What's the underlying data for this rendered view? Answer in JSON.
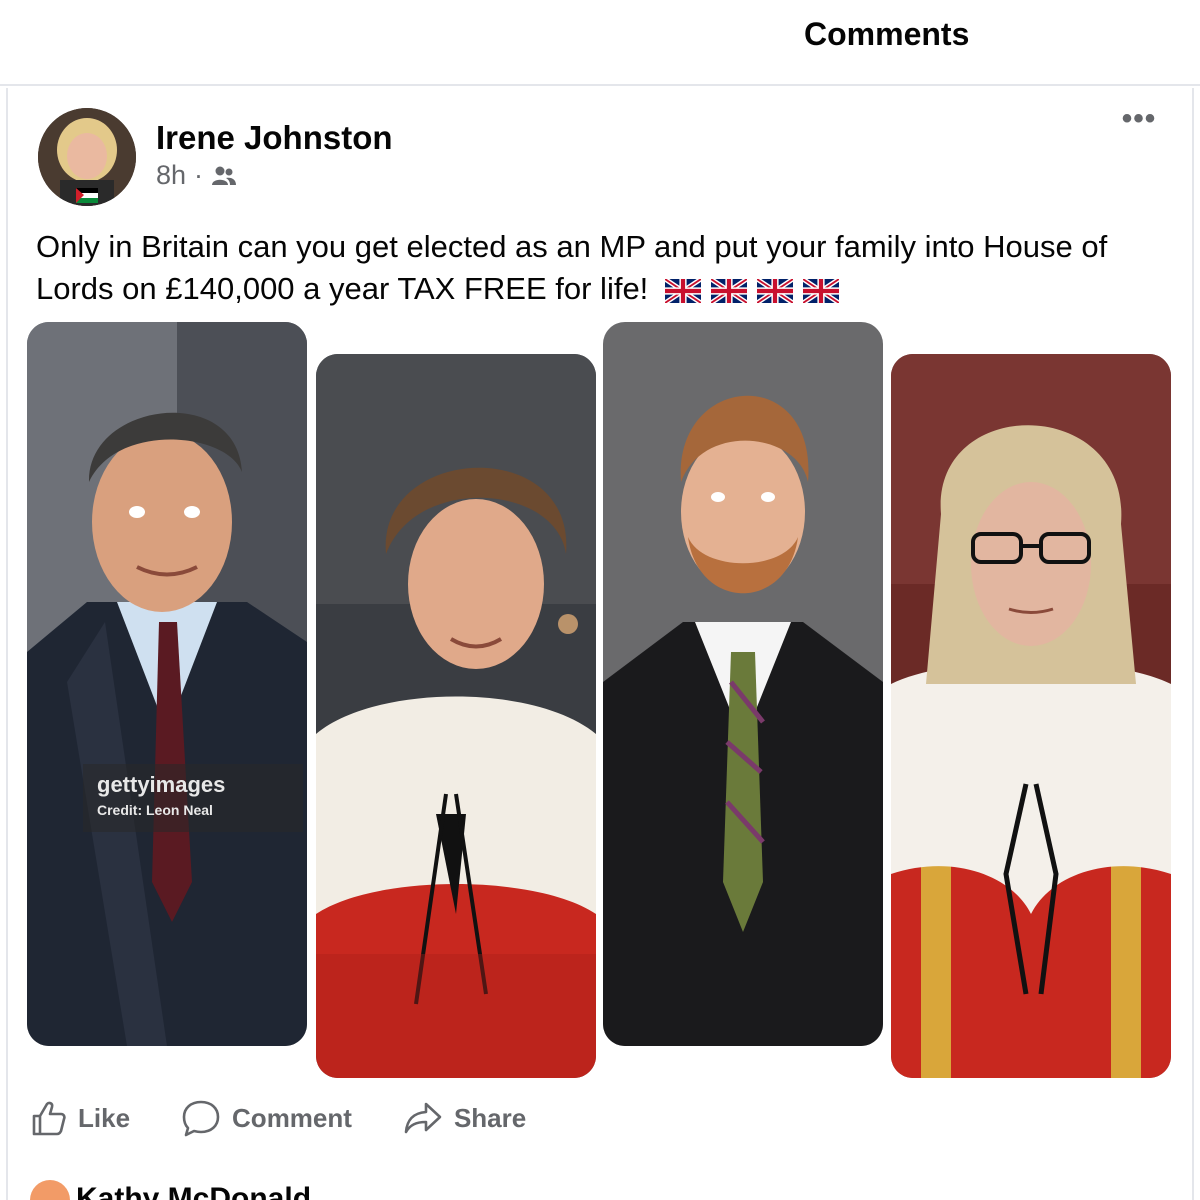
{
  "header": {
    "title": "Comments"
  },
  "post": {
    "author": "Irene Johnston",
    "time": "8h",
    "separator": "·",
    "audience_icon": "friends-icon",
    "more_icon": "more-options-icon",
    "more_symbol": "•••",
    "text": "Only in Britain can you get elected as an MP and put your family into House  of Lords on £140,000 a year TAX FREE for life!",
    "flag_emoji_count": 4,
    "images": [
      {
        "watermark": {
          "brand": "gettyimages",
          "credit": "Credit: Leon Neal"
        }
      },
      {},
      {},
      {}
    ]
  },
  "actions": {
    "like": "Like",
    "comment": "Comment",
    "share": "Share"
  },
  "comment_preview": {
    "name": "Kathy McDonald"
  },
  "colors": {
    "text_primary": "#050505",
    "text_secondary": "#65676b",
    "divider": "#e4e6eb",
    "robe_red": "#c8281f",
    "ermine": "#f2ede4"
  }
}
